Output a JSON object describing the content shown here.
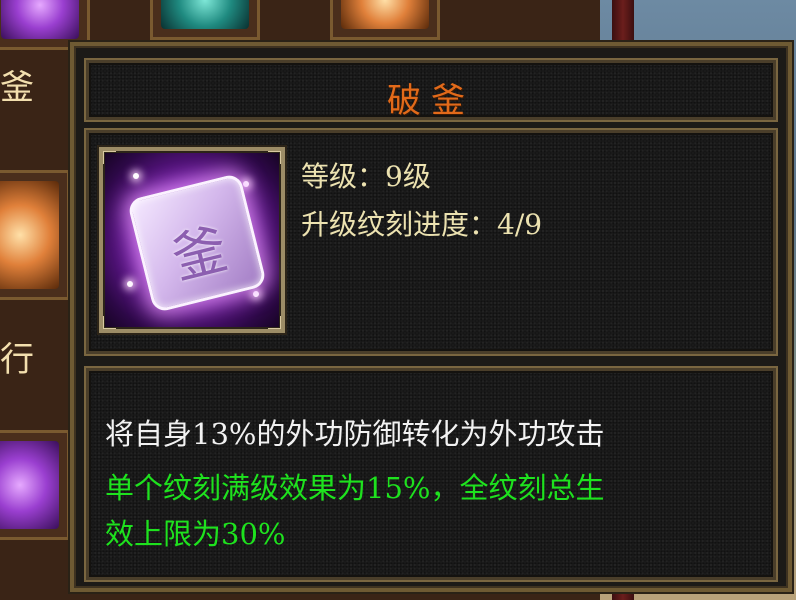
{
  "background": {
    "side_labels": [
      "釜",
      "行"
    ]
  },
  "tooltip": {
    "title": "破釜",
    "icon": {
      "name": "rune-fu-icon",
      "glyph": "釜"
    },
    "stats": {
      "level": "等级：9级",
      "progress": "升级纹刻进度：4/9"
    },
    "description": {
      "line1": "将自身13%的外功防御转化为外功攻击",
      "line2": "单个纹刻满级效果为15%，全纹刻总生",
      "line3": "效上限为30%"
    }
  },
  "colors": {
    "title": "#e26a1a",
    "stat_text": "#ece2b0",
    "desc_white": "#f2f2f2",
    "desc_green": "#1ee21e",
    "frame": "#6e5a33"
  }
}
